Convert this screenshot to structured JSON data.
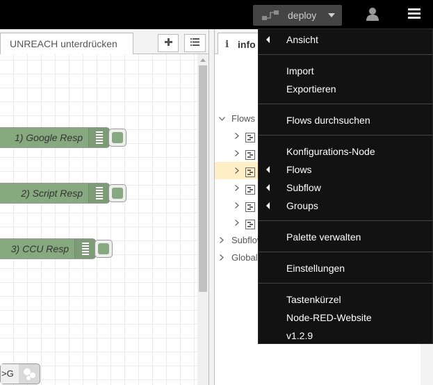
{
  "header": {
    "deploy_label": "deploy"
  },
  "workspace": {
    "tab_label": "UNREACH unterdrücken",
    "nodes": [
      {
        "label": "1) Google Resp"
      },
      {
        "label": "2) Script Resp"
      },
      {
        "label": "3) CCU Resp"
      }
    ],
    "bottom_node_label": ">G"
  },
  "sidebar": {
    "tab_icon": "i",
    "tab_label": "info",
    "tree": {
      "flows": "Flows",
      "subflows": "Subflow",
      "globals": "Global"
    }
  },
  "menu": {
    "items": [
      {
        "label": "Ansicht"
      },
      {
        "label": "Import"
      },
      {
        "label": "Exportieren"
      },
      {
        "label": "Flows durchsuchen"
      },
      {
        "label": "Konfigurations-Node"
      },
      {
        "label": "Flows"
      },
      {
        "label": "Subflow"
      },
      {
        "label": "Groups"
      },
      {
        "label": "Palette verwalten"
      },
      {
        "label": "Einstellungen"
      },
      {
        "label": "Tastenkürzel"
      },
      {
        "label": "Node-RED-Website"
      },
      {
        "label": "v1.2.9"
      }
    ]
  },
  "colors": {
    "header_bg": "#000000",
    "node_green": "#87a980",
    "menu_bg": "#121212",
    "selected_row": "#ffeec6"
  }
}
